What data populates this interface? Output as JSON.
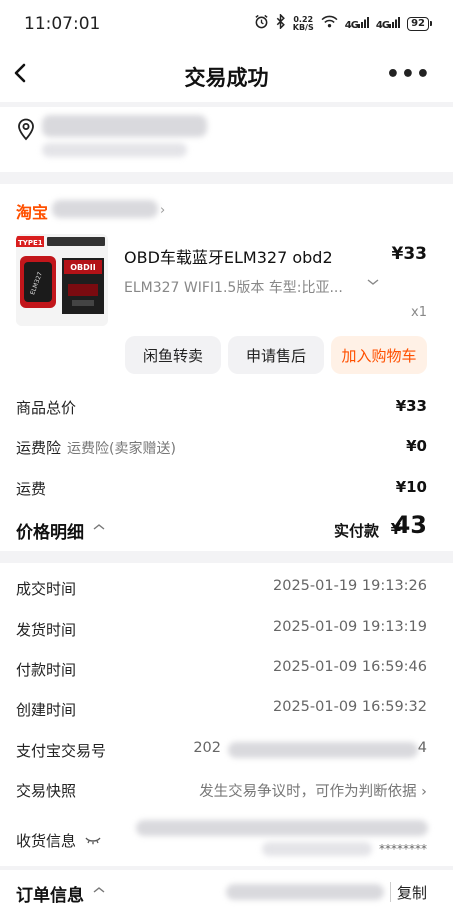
{
  "status_bar": {
    "time": "11:07:01",
    "speed_value": "0.22",
    "speed_unit": "KB/S",
    "signal_1": "4G",
    "signal_2": "4G",
    "battery": "92",
    "icons": [
      "alarm-icon",
      "bluetooth-icon",
      "wifi-icon",
      "signal-icon",
      "battery-icon"
    ]
  },
  "nav": {
    "title": "交易成功",
    "more": "•••"
  },
  "shop": {
    "platform": "淘宝",
    "arrow": "›"
  },
  "product": {
    "title": "OBD车载蓝牙ELM327 obd2",
    "price": "¥33",
    "sku": "ELM327 WIFI1.5版本 车型:比亚...",
    "quantity": "x1",
    "image_labels": {
      "tag": "TYPE1",
      "device": "ELM327",
      "box": "OBDII"
    }
  },
  "actions": [
    {
      "label": "闲鱼转卖"
    },
    {
      "label": "申请售后"
    },
    {
      "label": "加入购物车"
    }
  ],
  "price_rows": {
    "goods_total_label": "商品总价",
    "goods_total_value": "¥33",
    "insurance_label": "运费险",
    "insurance_sub": "运费险(卖家赠送)",
    "insurance_value": "¥0",
    "shipping_label": "运费",
    "shipping_value": "¥10"
  },
  "price_detail": {
    "title": "价格明细",
    "paid_label": "实付款",
    "paid_yen": "¥",
    "paid_amount": "43"
  },
  "order_info": {
    "deal_time_label": "成交时间",
    "deal_time": "2025-01-19 19:13:26",
    "ship_time_label": "发货时间",
    "ship_time": "2025-01-09 19:13:19",
    "pay_time_label": "付款时间",
    "pay_time": "2025-01-09 16:59:46",
    "create_time_label": "创建时间",
    "create_time": "2025-01-09 16:59:32",
    "alipay_label": "支付宝交易号",
    "alipay_prefix": "202",
    "alipay_suffix": "4",
    "snapshot_label": "交易快照",
    "snapshot_text": "发生交易争议时，可作为判断依据 ›",
    "receiver_label": "收货信息",
    "receiver_masked": "********",
    "order_title": "订单信息",
    "copy": "复制"
  },
  "colors": {
    "accent": "#ff5000",
    "page_bg": "#ffffff",
    "divider_bg": "#f3f3f5",
    "button_bg": "#f2f2f4",
    "button_accent_bg": "#fff1e6"
  }
}
